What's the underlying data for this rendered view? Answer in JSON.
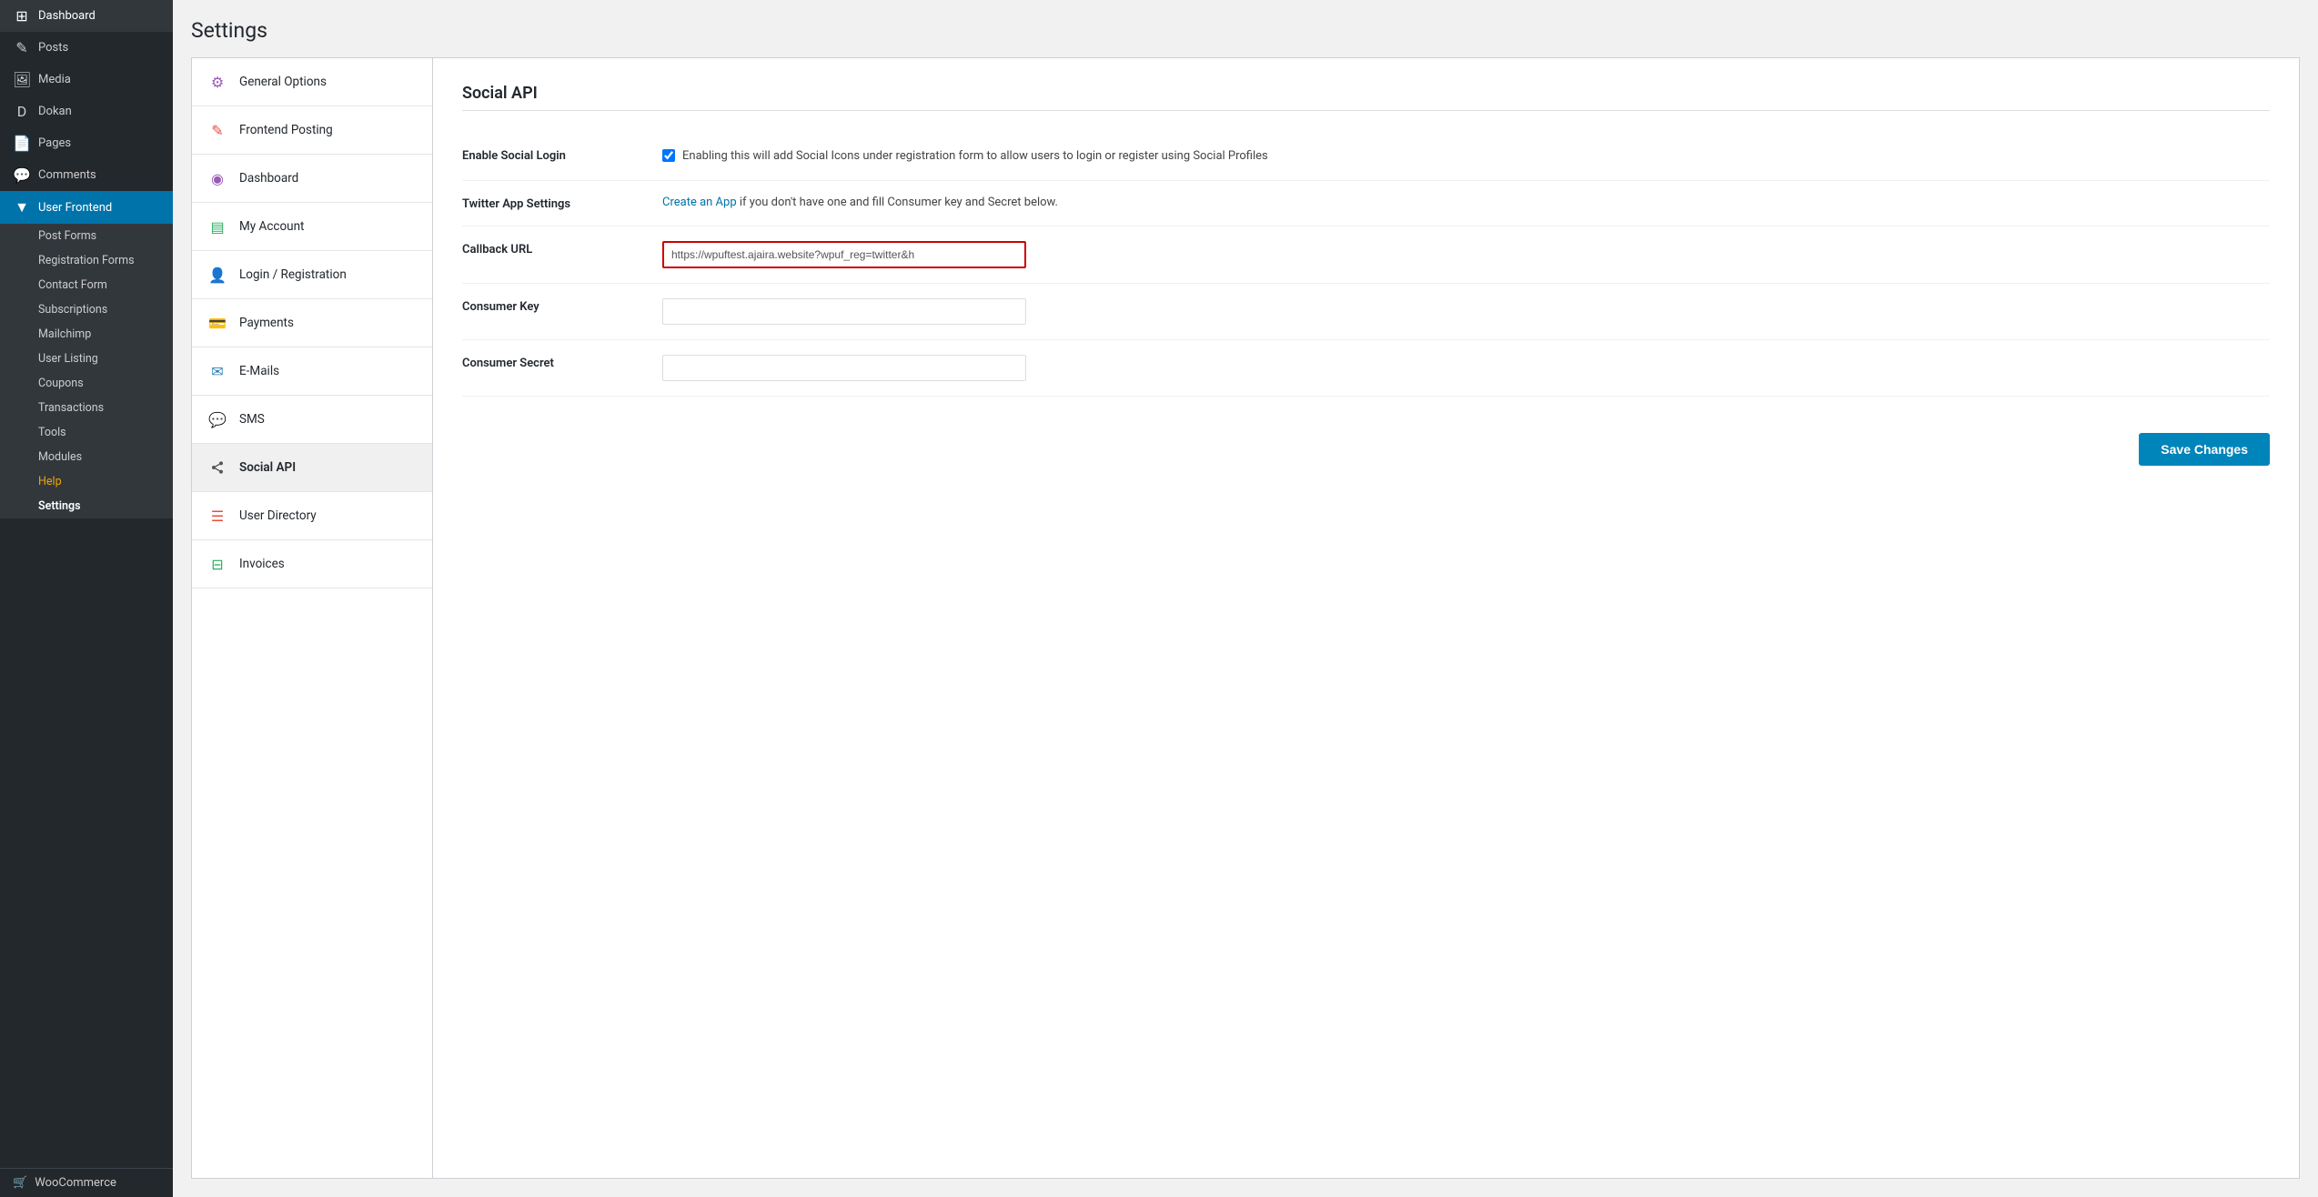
{
  "sidebar": {
    "items": [
      {
        "id": "dashboard",
        "label": "Dashboard",
        "icon": "⊞",
        "active": false
      },
      {
        "id": "posts",
        "label": "Posts",
        "icon": "✎",
        "active": false
      },
      {
        "id": "media",
        "label": "Media",
        "icon": "◫",
        "active": false
      },
      {
        "id": "dokan",
        "label": "Dokan",
        "icon": "D",
        "active": false
      },
      {
        "id": "pages",
        "label": "Pages",
        "icon": "⊡",
        "active": false
      },
      {
        "id": "comments",
        "label": "Comments",
        "icon": "💬",
        "active": false
      },
      {
        "id": "user-frontend",
        "label": "User Frontend",
        "icon": "▼",
        "active": true
      }
    ],
    "submenu": [
      {
        "id": "post-forms",
        "label": "Post Forms"
      },
      {
        "id": "registration-forms",
        "label": "Registration Forms"
      },
      {
        "id": "contact-form",
        "label": "Contact Form"
      },
      {
        "id": "subscriptions",
        "label": "Subscriptions"
      },
      {
        "id": "mailchimp",
        "label": "Mailchimp"
      },
      {
        "id": "user-listing",
        "label": "User Listing"
      },
      {
        "id": "coupons",
        "label": "Coupons"
      },
      {
        "id": "transactions",
        "label": "Transactions"
      },
      {
        "id": "tools",
        "label": "Tools"
      },
      {
        "id": "modules",
        "label": "Modules"
      },
      {
        "id": "help",
        "label": "Help",
        "orange": true
      },
      {
        "id": "settings",
        "label": "Settings",
        "bold": true
      }
    ],
    "woocommerce": "WooCommerce"
  },
  "page": {
    "title": "Settings"
  },
  "settings_nav": {
    "items": [
      {
        "id": "general-options",
        "label": "General Options",
        "icon": "⚙",
        "icon_color": "#9b59b6",
        "active": false
      },
      {
        "id": "frontend-posting",
        "label": "Frontend Posting",
        "icon": "✎",
        "icon_color": "#e74c3c",
        "active": false
      },
      {
        "id": "dashboard",
        "label": "Dashboard",
        "icon": "◉",
        "icon_color": "#9b59b6",
        "active": false
      },
      {
        "id": "my-account",
        "label": "My Account",
        "icon": "▤",
        "icon_color": "#27ae60",
        "active": false
      },
      {
        "id": "login-registration",
        "label": "Login / Registration",
        "icon": "👤",
        "icon_color": "#3498db",
        "active": false
      },
      {
        "id": "payments",
        "label": "Payments",
        "icon": "💳",
        "icon_color": "#e67e22",
        "active": false
      },
      {
        "id": "e-mails",
        "label": "E-Mails",
        "icon": "✉",
        "icon_color": "#2980b9",
        "active": false
      },
      {
        "id": "sms",
        "label": "SMS",
        "icon": "💬",
        "icon_color": "#1abc9c",
        "active": false
      },
      {
        "id": "social-api",
        "label": "Social API",
        "icon": "⬡",
        "icon_color": "#555",
        "active": true
      },
      {
        "id": "user-directory",
        "label": "User Directory",
        "icon": "☰",
        "icon_color": "#e74c3c",
        "active": false
      },
      {
        "id": "invoices",
        "label": "Invoices",
        "icon": "⊟",
        "icon_color": "#27ae60",
        "active": false
      }
    ]
  },
  "panel": {
    "title": "Social API",
    "fields": [
      {
        "id": "enable-social-login",
        "label": "Enable Social Login",
        "type": "checkbox",
        "checked": true,
        "description": "Enabling this will add Social Icons under registration form to allow users to login or register using Social Profiles"
      },
      {
        "id": "twitter-app-settings",
        "label": "Twitter App Settings",
        "type": "link",
        "link_text": "Create an App",
        "link_suffix": " if you don't have one and fill Consumer key and Secret below."
      },
      {
        "id": "callback-url",
        "label": "Callback URL",
        "type": "input-highlighted",
        "value": "https://wpuftest.ajaira.website?wpuf_reg=twitter&h"
      },
      {
        "id": "consumer-key",
        "label": "Consumer Key",
        "type": "input",
        "value": ""
      },
      {
        "id": "consumer-secret",
        "label": "Consumer Secret",
        "type": "input",
        "value": ""
      }
    ],
    "save_button": "Save Changes"
  }
}
